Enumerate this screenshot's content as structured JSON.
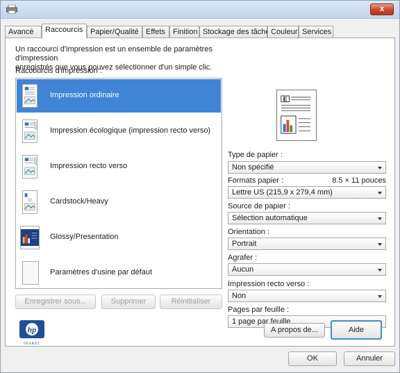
{
  "window": {
    "close_label": "x"
  },
  "tabs": [
    {
      "label": "Avancé"
    },
    {
      "label": "Raccourcis",
      "active": true
    },
    {
      "label": "Papier/Qualité"
    },
    {
      "label": "Effets"
    },
    {
      "label": "Finition"
    },
    {
      "label": "Stockage des tâches"
    },
    {
      "label": "Couleur"
    },
    {
      "label": "Services"
    }
  ],
  "shortcuts": {
    "description_line1": "Un raccourci d'impression est un ensemble de paramètres d'impression",
    "description_line2": "enregistrés que vous pouvez sélectionner d'un simple clic.",
    "list_label": "Raccourcis d'impression :",
    "items": [
      {
        "label": "Impression ordinaire",
        "selected": true,
        "icon": "document-photo-icon"
      },
      {
        "label": "Impression écologique (impression recto verso)",
        "icon": "eco-duplex-icon"
      },
      {
        "label": "Impression recto verso",
        "icon": "duplex-icon"
      },
      {
        "label": "Cardstock/Heavy",
        "icon": "cardstock-icon"
      },
      {
        "label": "Glossy/Presentation",
        "icon": "glossy-photo-icon"
      },
      {
        "label": "Paramètres d'usine par défaut",
        "icon": "blank-page-icon"
      }
    ],
    "buttons": {
      "save_as": "Enregistrer sous...",
      "delete": "Supprimer",
      "reset": "Réinitialiser"
    }
  },
  "settings": {
    "paper_type_label": "Type de papier :",
    "paper_type_value": "Non spécifié",
    "paper_size_label": "Formats papier :",
    "paper_size_dims": "8.5 × 11 pouces",
    "paper_size_value": "Lettre US (215,9 x 279,4 mm)",
    "paper_source_label": "Source de papier :",
    "paper_source_value": "Sélection automatique",
    "orientation_label": "Orientation :",
    "orientation_value": "Portrait",
    "staple_label": "Agrafer :",
    "staple_value": "Aucun",
    "duplex_label": "Impression recto verso :",
    "duplex_value": "Non",
    "pages_per_sheet_label": "Pages par feuille :",
    "pages_per_sheet_value": "1 page par feuille"
  },
  "footer": {
    "about_label": "A propos de...",
    "help_label": "Aide",
    "ok_label": "OK",
    "cancel_label": "Annuler",
    "brand_text": "invent"
  },
  "colors": {
    "selection": "#3f84d6",
    "focus_border": "#3d8ec9",
    "hp_blue": "#1f4f96"
  }
}
